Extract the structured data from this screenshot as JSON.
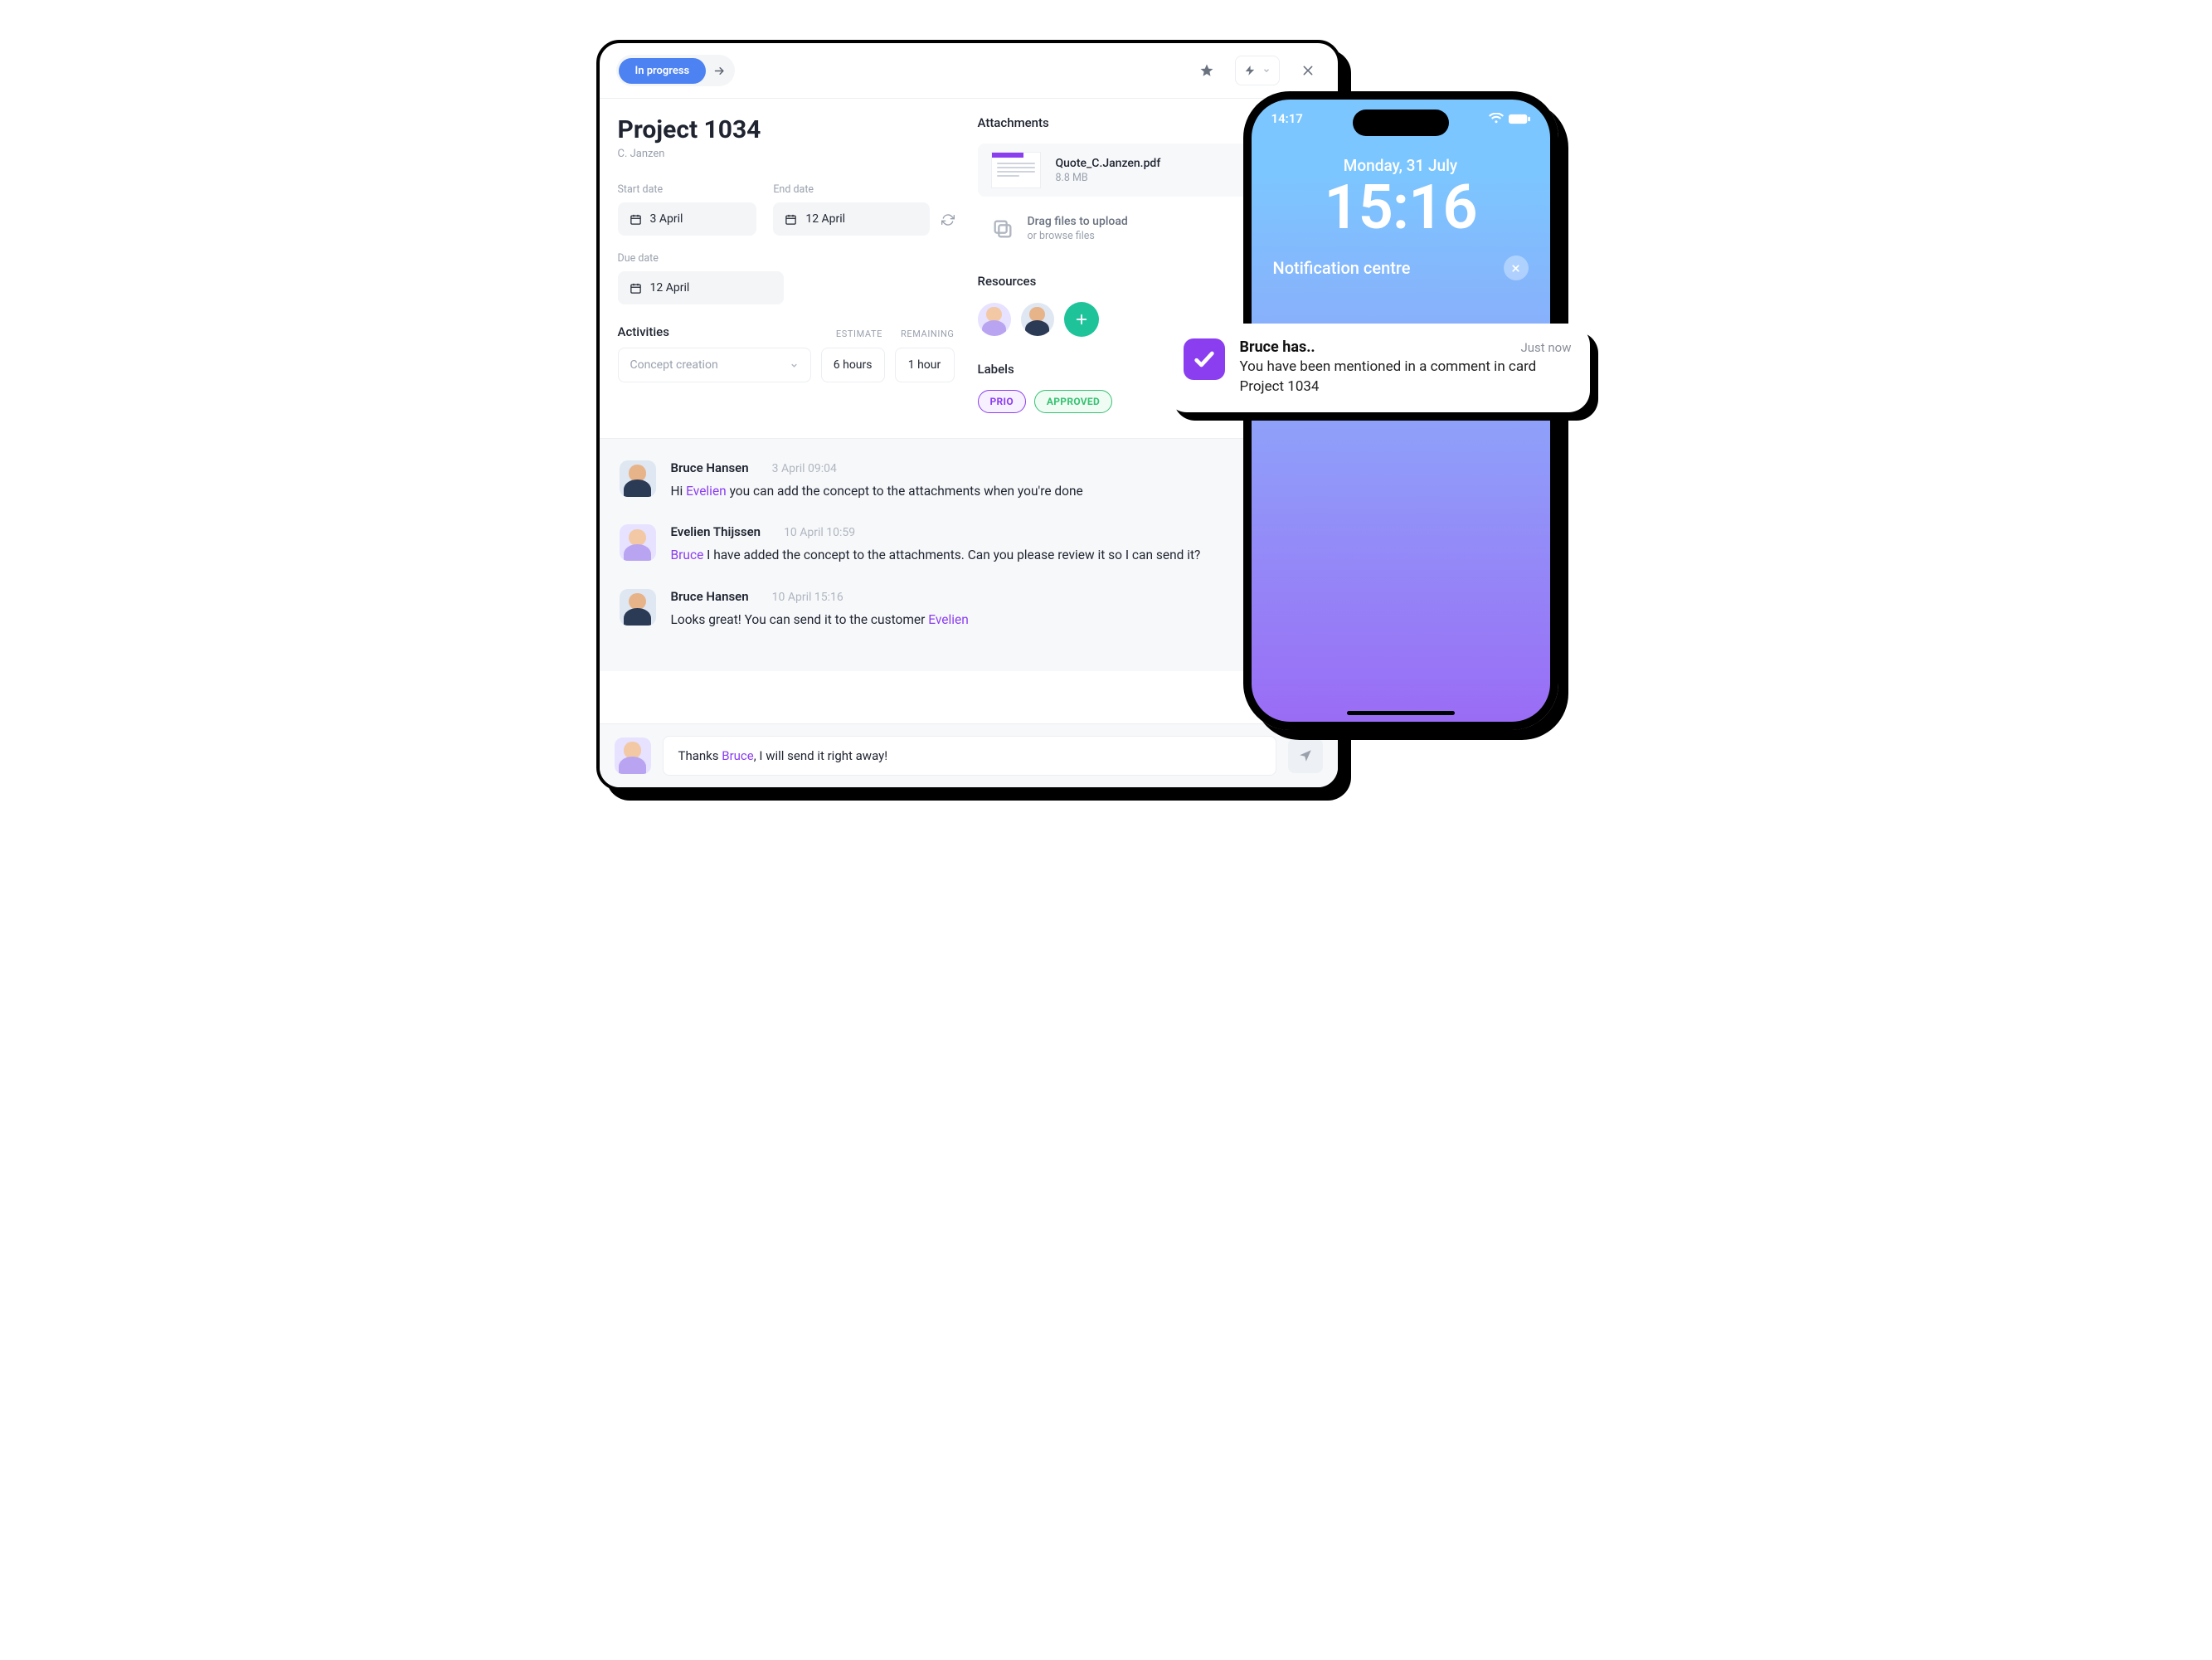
{
  "header": {
    "status_label": "In progress"
  },
  "project": {
    "title": "Project 1034",
    "owner": "C. Janzen",
    "start_date_label": "Start date",
    "start_date": "3 April",
    "end_date_label": "End date",
    "end_date": "12 April",
    "due_date_label": "Due date",
    "due_date": "12 April"
  },
  "attachments": {
    "heading": "Attachments",
    "file_name": "Quote_C.Janzen.pdf",
    "file_size": "8.8 MB",
    "drop_title": "Drag files to upload",
    "drop_sub": "or browse files"
  },
  "resources": {
    "heading": "Resources"
  },
  "labels": {
    "heading": "Labels",
    "prio": "PRIO",
    "approved": "APPROVED"
  },
  "activities": {
    "heading": "Activities",
    "col_estimate": "ESTIMATE",
    "col_remaining": "REMAINING",
    "selected": "Concept creation",
    "estimate": "6 hours",
    "remaining": "1 hour"
  },
  "comments": [
    {
      "author": "Bruce Hansen",
      "time": "3 April 09:04",
      "pre": "Hi ",
      "mention": "Evelien",
      "post": " you can add the concept to the attachments when you're done",
      "gender": "male"
    },
    {
      "author": "Evelien Thijssen",
      "time": "10 April 10:59",
      "pre": "",
      "mention": "Bruce",
      "post": " I have added the concept to the attachments. Can you please review it so I can send it?",
      "gender": "female"
    },
    {
      "author": "Bruce Hansen",
      "time": "10 April 15:16",
      "pre": "Looks great! You can send it to the customer ",
      "mention": "Evelien",
      "post": "",
      "gender": "male"
    }
  ],
  "compose": {
    "pre": "Thanks ",
    "mention": "Bruce",
    "post": ", I will send it right away!"
  },
  "phone": {
    "status_time": "14:17",
    "lock_date": "Monday, 31 July",
    "lock_time": "15:16",
    "nc_heading": "Notification centre"
  },
  "toast": {
    "title": "Bruce has..",
    "time": "Just now",
    "body": "You have been mentioned in a comment in card Project 1034"
  }
}
